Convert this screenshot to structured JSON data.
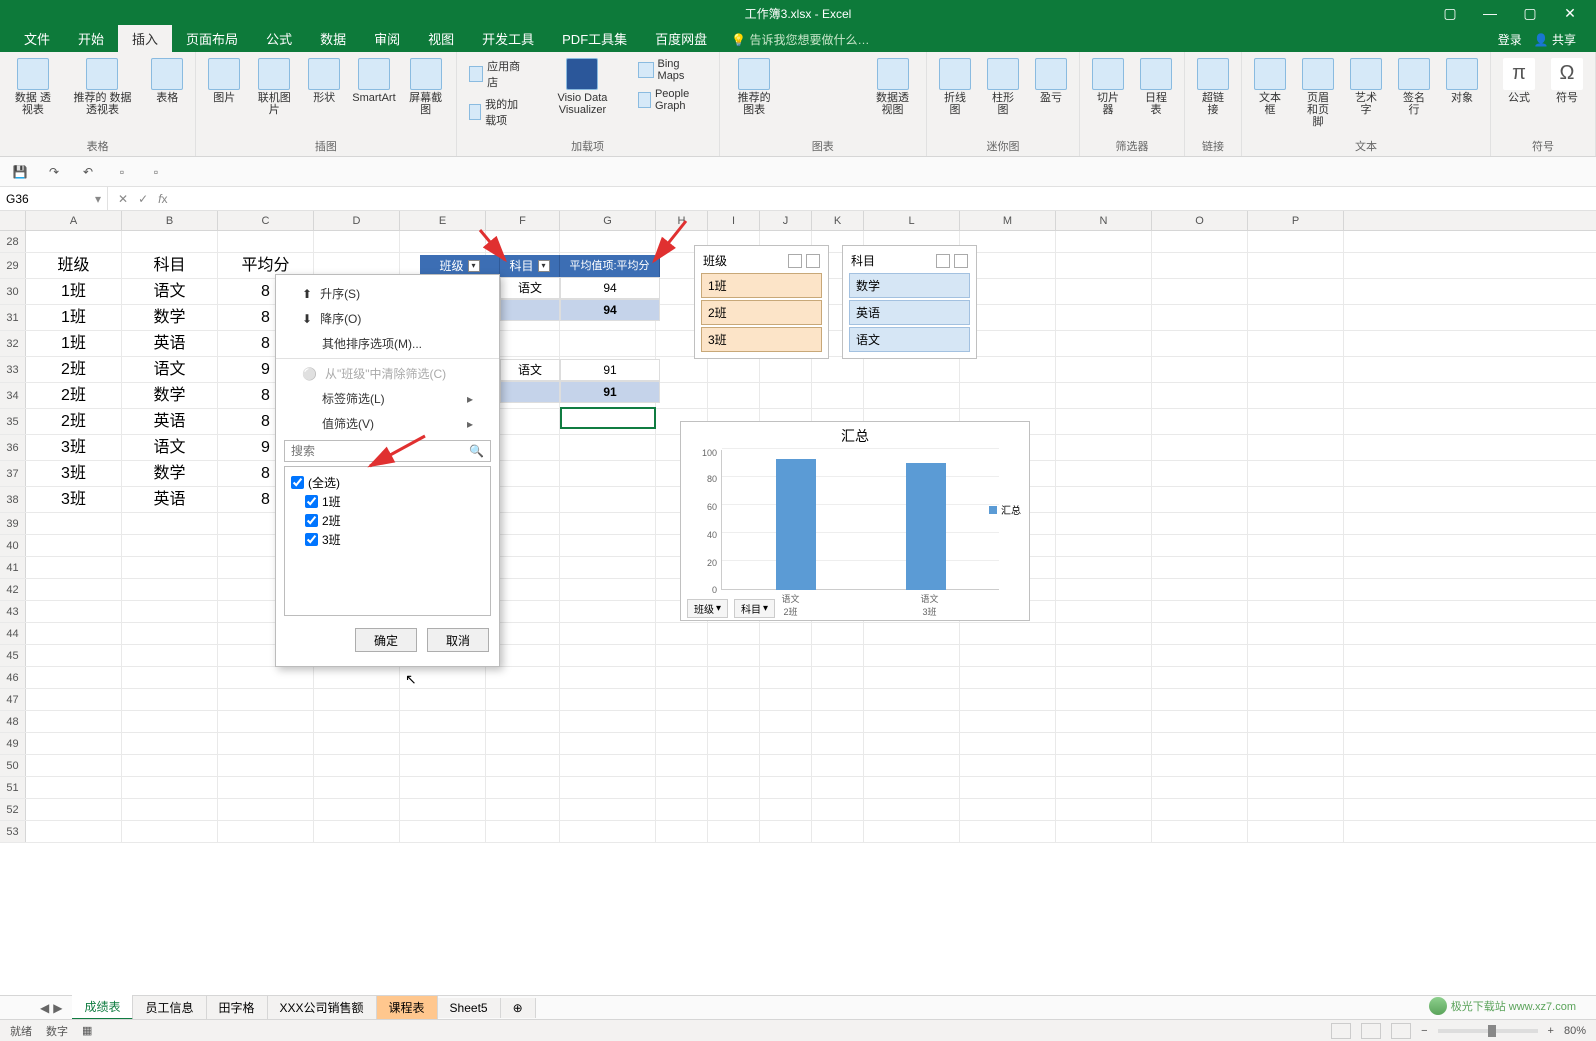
{
  "window": {
    "title": "工作簿3.xlsx - Excel",
    "login": "登录",
    "share": "共享"
  },
  "menu": {
    "items": [
      "文件",
      "开始",
      "插入",
      "页面布局",
      "公式",
      "数据",
      "审阅",
      "视图",
      "开发工具",
      "PDF工具集",
      "百度网盘"
    ],
    "active": "插入",
    "tell_me": "告诉我您想要做什么…"
  },
  "ribbon": {
    "groups": {
      "tables": {
        "name": "表格",
        "pivot": "数据\n透视表",
        "rec_pivot": "推荐的\n数据透视表",
        "table": "表格"
      },
      "illus": {
        "name": "插图",
        "pic": "图片",
        "online_pic": "联机图片",
        "shapes": "形状",
        "smartart": "SmartArt",
        "screenshot": "屏幕截图"
      },
      "addins": {
        "name": "加载项",
        "store": "应用商店",
        "my": "我的加载项",
        "visio": "Visio Data\nVisualizer",
        "bing": "Bing Maps",
        "people": "People Graph"
      },
      "charts": {
        "name": "图表",
        "rec": "推荐的\n图表",
        "pivot_chart": "数据透视图"
      },
      "spark": {
        "name": "迷你图",
        "line": "折线图",
        "col": "柱形图",
        "winloss": "盈亏"
      },
      "filter": {
        "name": "筛选器",
        "slicer": "切片器",
        "timeline": "日程表"
      },
      "links": {
        "name": "链接",
        "hyper": "超链接"
      },
      "text": {
        "name": "文本",
        "textbox": "文本框",
        "hf": "页眉和页脚",
        "wordart": "艺术字",
        "sig": "签名行",
        "obj": "对象"
      },
      "sym": {
        "name": "符号",
        "eq": "公式",
        "symbol": "符号"
      }
    }
  },
  "namebox": "G36",
  "columns": [
    "A",
    "B",
    "C",
    "D",
    "E",
    "F",
    "G",
    "H",
    "I",
    "J",
    "K",
    "L",
    "M",
    "N",
    "O",
    "P"
  ],
  "row_start": 28,
  "row_end": 53,
  "grid_data": {
    "headers": {
      "A": "班级",
      "B": "科目",
      "C": "平均分"
    },
    "rows": [
      {
        "A": "1班",
        "B": "语文",
        "C": "8"
      },
      {
        "A": "1班",
        "B": "数学",
        "C": "8"
      },
      {
        "A": "1班",
        "B": "英语",
        "C": "8"
      },
      {
        "A": "2班",
        "B": "语文",
        "C": "9"
      },
      {
        "A": "2班",
        "B": "数学",
        "C": "8"
      },
      {
        "A": "2班",
        "B": "英语",
        "C": "8"
      },
      {
        "A": "3班",
        "B": "语文",
        "C": "9"
      },
      {
        "A": "3班",
        "B": "数学",
        "C": "8"
      },
      {
        "A": "3班",
        "B": "英语",
        "C": "8"
      }
    ]
  },
  "pivot": {
    "headers": {
      "class": "班级",
      "subject": "科目",
      "val": "平均值项:平均分"
    },
    "rows": [
      {
        "sub": "语文",
        "val": "94",
        "type": "row"
      },
      {
        "val": "94",
        "type": "sub"
      },
      {
        "type": "gap"
      },
      {
        "sub": "语文",
        "val": "91",
        "type": "row"
      },
      {
        "val": "91",
        "type": "sub"
      }
    ]
  },
  "filter_menu": {
    "asc": "升序(S)",
    "desc": "降序(O)",
    "other_sort": "其他排序选项(M)...",
    "clear": "从\"班级\"中清除筛选(C)",
    "label_filter": "标签筛选(L)",
    "value_filter": "值筛选(V)",
    "search_ph": "搜索",
    "all": "(全选)",
    "items": [
      "1班",
      "2班",
      "3班"
    ],
    "ok": "确定",
    "cancel": "取消"
  },
  "slicer1": {
    "title": "班级",
    "items": [
      "1班",
      "2班",
      "3班"
    ]
  },
  "slicer2": {
    "title": "科目",
    "items": [
      "数学",
      "英语",
      "语文"
    ]
  },
  "chart_data": {
    "type": "bar",
    "title": "汇总",
    "categories": [
      "语文",
      "语文"
    ],
    "sub_categories": [
      "2班",
      "3班"
    ],
    "values": [
      94,
      91
    ],
    "ylim": [
      0,
      100
    ],
    "yticks": [
      0,
      20,
      40,
      60,
      80,
      100
    ],
    "legend": "汇总",
    "filters": [
      "班级",
      "科目"
    ]
  },
  "tabs": {
    "items": [
      "成绩表",
      "员工信息",
      "田字格",
      "XXX公司销售额",
      "课程表",
      "Sheet5"
    ],
    "active": "成绩表",
    "orange": "课程表"
  },
  "status": {
    "ready": "就绪",
    "num": "数字",
    "zoom": "80%"
  },
  "watermark": "极光下载站 www.xz7.com"
}
